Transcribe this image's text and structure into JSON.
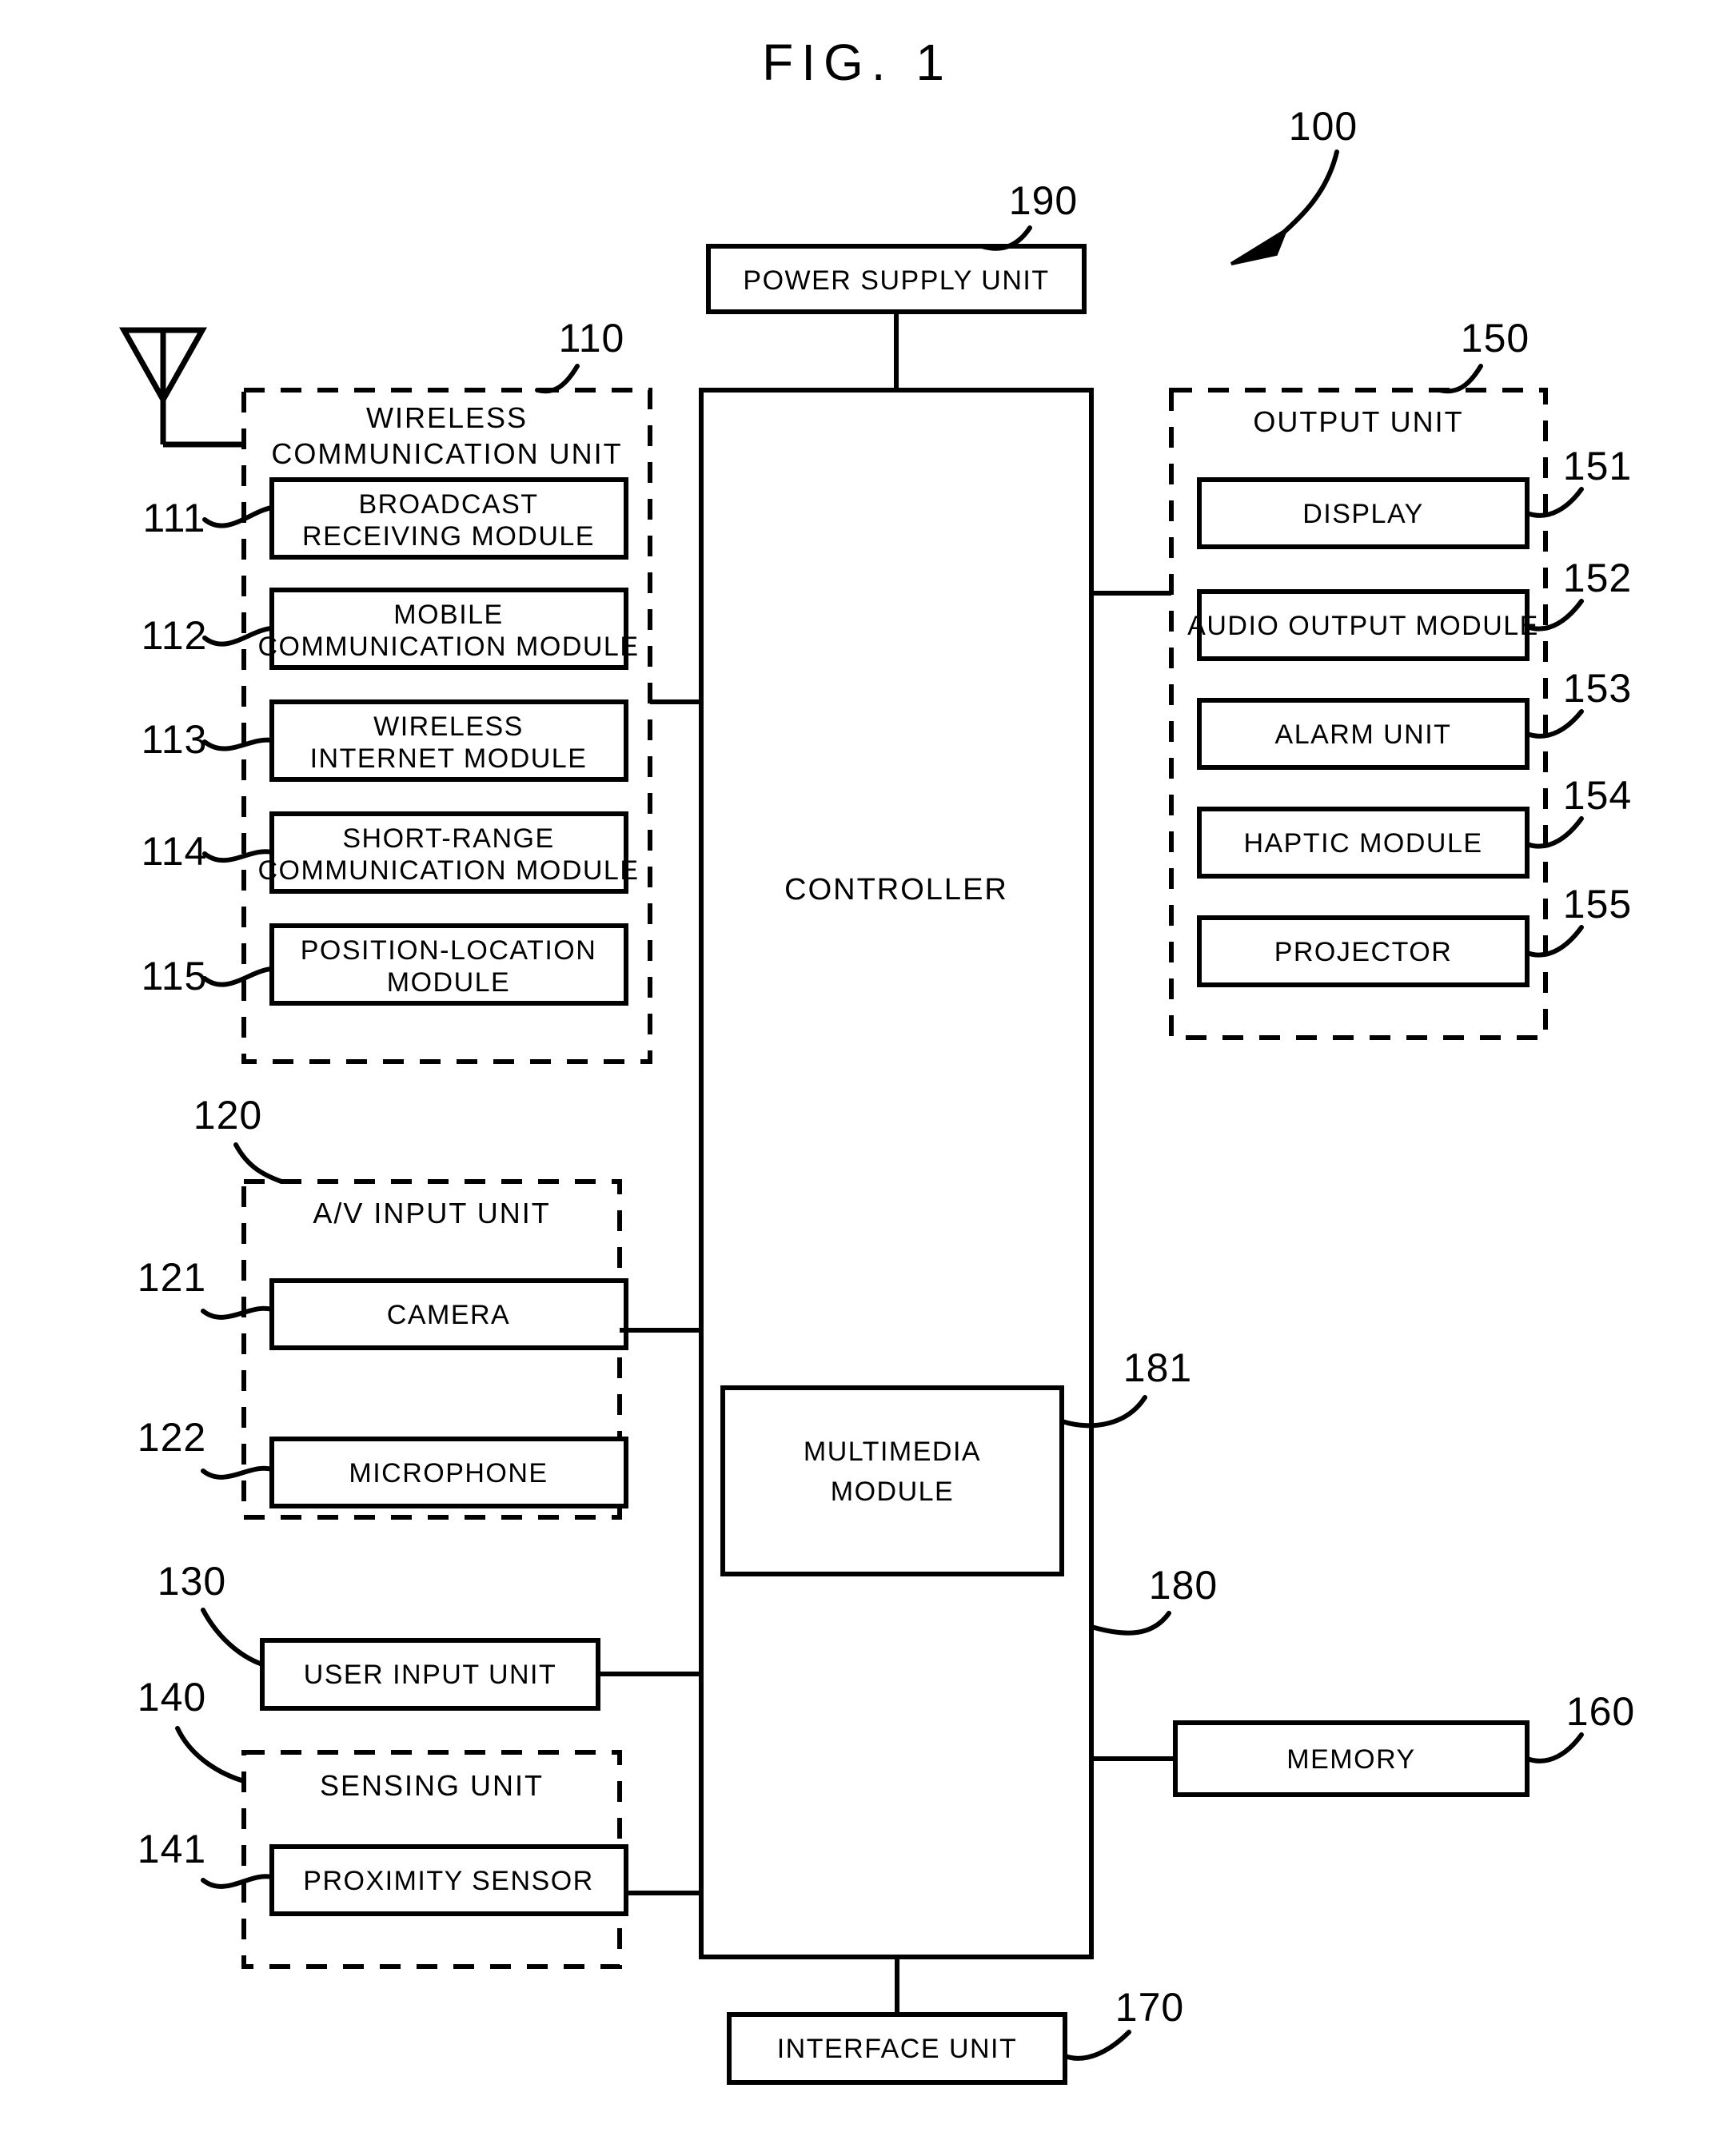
{
  "figure": {
    "title": "FIG. 1",
    "device_ref": "100"
  },
  "power_supply": {
    "label": "POWER SUPPLY UNIT",
    "ref": "190"
  },
  "controller": {
    "label": "CONTROLLER",
    "ref": "180",
    "multimedia_module": {
      "label": "MULTIMEDIA\nMODULE",
      "line1": "MULTIMEDIA",
      "line2": "MODULE",
      "ref": "181"
    }
  },
  "wireless_communication_unit": {
    "title_line1": "WIRELESS",
    "title_line2": "COMMUNICATION UNIT",
    "ref": "110",
    "modules": [
      {
        "ref": "111",
        "line1": "BROADCAST",
        "line2": "RECEIVING MODULE"
      },
      {
        "ref": "112",
        "line1": "MOBILE",
        "line2": "COMMUNICATION MODULE"
      },
      {
        "ref": "113",
        "line1": "WIRELESS",
        "line2": "INTERNET MODULE"
      },
      {
        "ref": "114",
        "line1": "SHORT-RANGE",
        "line2": "COMMUNICATION MODULE"
      },
      {
        "ref": "115",
        "line1": "POSITION-LOCATION",
        "line2": "MODULE"
      }
    ]
  },
  "av_input_unit": {
    "title": "A/V INPUT UNIT",
    "ref": "120",
    "modules": [
      {
        "ref": "121",
        "label": "CAMERA"
      },
      {
        "ref": "122",
        "label": "MICROPHONE"
      }
    ]
  },
  "user_input_unit": {
    "label": "USER INPUT UNIT",
    "ref": "130"
  },
  "sensing_unit": {
    "title": "SENSING UNIT",
    "ref": "140",
    "modules": [
      {
        "ref": "141",
        "label": "PROXIMITY SENSOR"
      }
    ]
  },
  "output_unit": {
    "title": "OUTPUT UNIT",
    "ref": "150",
    "modules": [
      {
        "ref": "151",
        "label": "DISPLAY"
      },
      {
        "ref": "152",
        "label": "AUDIO OUTPUT MODULE"
      },
      {
        "ref": "153",
        "label": "ALARM UNIT"
      },
      {
        "ref": "154",
        "label": "HAPTIC MODULE"
      },
      {
        "ref": "155",
        "label": "PROJECTOR"
      }
    ]
  },
  "memory": {
    "label": "MEMORY",
    "ref": "160"
  },
  "interface_unit": {
    "label": "INTERFACE UNIT",
    "ref": "170"
  },
  "icons": {
    "antenna": "antenna-icon",
    "pointer_arrow": "curved-arrow-icon"
  },
  "colors": {
    "ink": "#000000",
    "paper": "#ffffff"
  }
}
